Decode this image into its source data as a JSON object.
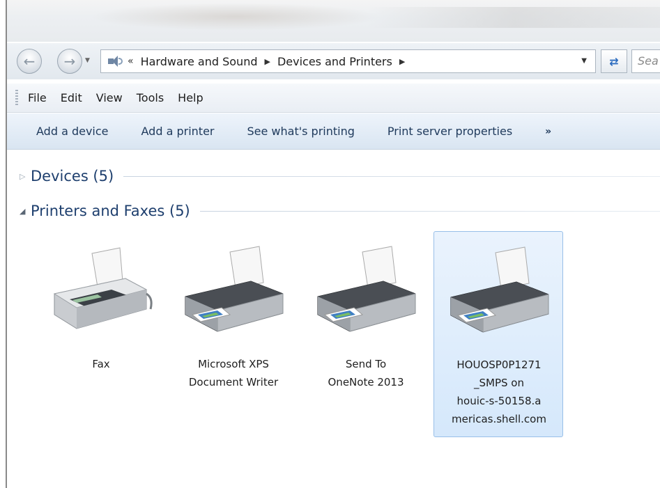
{
  "window": {
    "address": {
      "overflow_chevron": "«",
      "crumbs": [
        "Hardware and Sound",
        "Devices and Printers"
      ],
      "search_placeholder": "Sea"
    },
    "menu": [
      "File",
      "Edit",
      "View",
      "Tools",
      "Help"
    ],
    "commands": [
      "Add a device",
      "Add a printer",
      "See what's printing",
      "Print server properties"
    ],
    "more_commands": "»",
    "groups": {
      "devices": {
        "label": "Devices (5)",
        "expanded": false
      },
      "printers": {
        "label": "Printers and Faxes (5)",
        "expanded": true
      }
    },
    "printers": [
      {
        "name": "Fax",
        "icon": "fax-icon",
        "selected": false
      },
      {
        "name": "Microsoft XPS\nDocument Writer",
        "icon": "printer-icon",
        "selected": false
      },
      {
        "name": "Send To\nOneNote 2013",
        "icon": "printer-icon",
        "selected": false
      },
      {
        "name": "HOUOSP0P1271\n_SMPS on\nhouic-s-50158.a\nmericas.shell.com",
        "icon": "printer-icon",
        "selected": true
      }
    ]
  },
  "colors": {
    "group_header": "#1e3f6e",
    "command_text": "#1e395b",
    "selection_fill": "#d5e8fb",
    "selection_border": "#98bfe8"
  }
}
